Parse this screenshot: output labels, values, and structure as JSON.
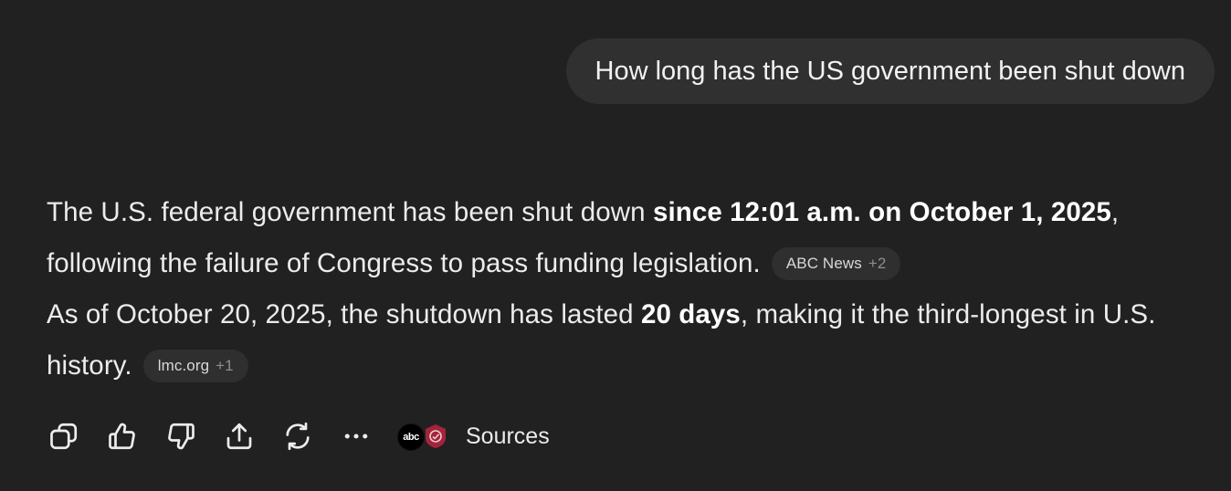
{
  "conversation": {
    "user_message": "How long has the US government been shut down",
    "answer": {
      "p1_before": "The U.S. federal government has been shut down ",
      "p1_bold": "since 12:01 a.m. on October 1, 2025",
      "p1_after": ", following the failure of Congress to pass funding legislation.",
      "p1_chip": {
        "label": "ABC News",
        "more": "+2"
      },
      "p2_before": "As of October 20, 2025, the shutdown has lasted ",
      "p2_bold": "20 days",
      "p2_after": ", making it the third-longest in U.S. history.",
      "p2_chip": {
        "label": "lmc.org",
        "more": "+1"
      }
    }
  },
  "toolbar": {
    "icons": [
      "copy-icon",
      "thumbs-up-icon",
      "thumbs-down-icon",
      "share-icon",
      "regenerate-icon",
      "more-icon"
    ],
    "sources_label": "Sources",
    "source_logo_abc": "abc",
    "colors": {
      "background": "#212121",
      "bubble": "#303030",
      "chip": "#2f2f2f",
      "lmc_red": "#a3243b"
    }
  }
}
